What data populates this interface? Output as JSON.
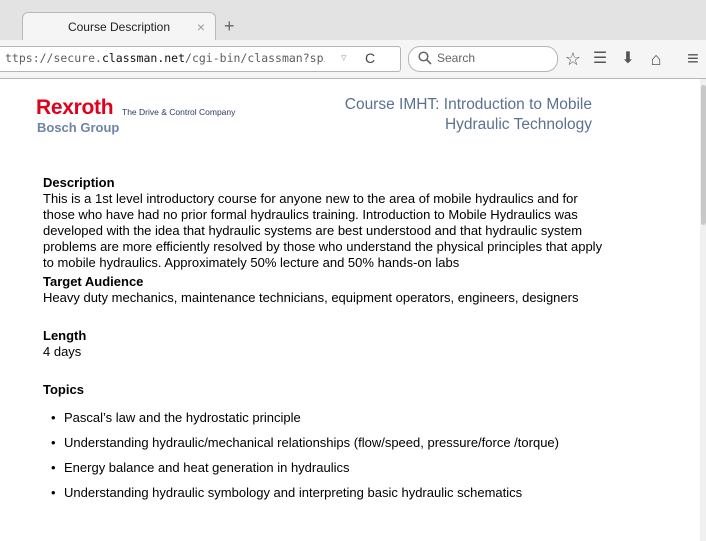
{
  "browser": {
    "tab_title": "Course Description",
    "tab_close": "×",
    "new_tab": "+",
    "url_prefix": "ttps://secure.",
    "url_domain": "classman.net",
    "url_rest": "/cgi-bin/classman?spid:course+tpid:c",
    "url_dropdown": "▿",
    "reload": "C",
    "search_placeholder": "Search",
    "icons": {
      "bookmark": "☆",
      "reading_list": "☰",
      "download": "⬇",
      "home": "⌂",
      "menu": "≡"
    }
  },
  "header": {
    "logo_main": "Rexroth",
    "logo_sub": "Bosch Group",
    "tagline": "The Drive & Control Company",
    "course_title_line1": "Course IMHT: Introduction to Mobile",
    "course_title_line2": "Hydraulic Technology"
  },
  "sections": {
    "description_heading": "Description",
    "description_text": "This is a 1st level introductory course for anyone new to the area of mobile hydraulics and for those who have had no prior formal hydraulics training. Introduction to Mobile Hydraulics was developed with the idea that hydraulic systems are best understood and that hydraulic system problems are more efficiently resolved by those who understand the physical principles that apply to mobile hydraulics. Approximately 50% lecture and 50% hands-on labs",
    "audience_heading": "Target Audience",
    "audience_text": "Heavy duty mechanics, maintenance technicians, equipment operators, engineers, designers",
    "length_heading": "Length",
    "length_text": "4 days",
    "topics_heading": "Topics",
    "topics": [
      "Pascal’s law and the hydrostatic principle",
      "Understanding hydraulic/mechanical relationships (flow/speed, pressure/force /torque)",
      "Energy balance and heat generation in hydraulics",
      "Understanding hydraulic symbology and interpreting basic hydraulic schematics"
    ]
  }
}
